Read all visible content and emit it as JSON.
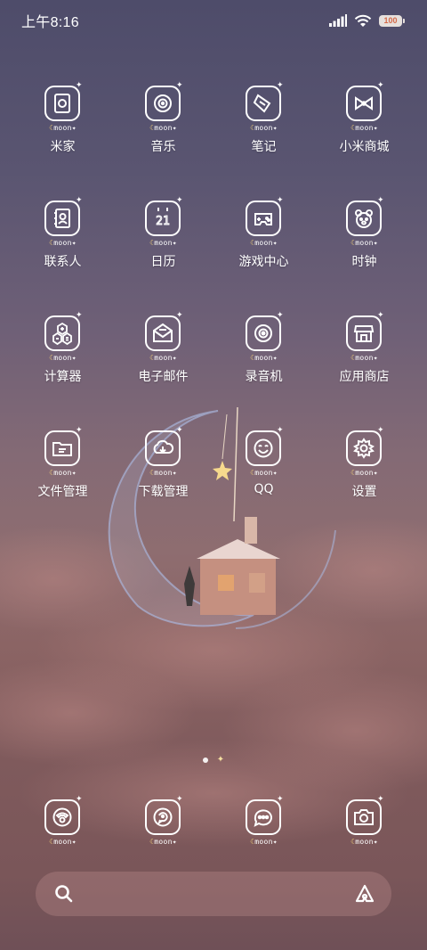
{
  "status_bar": {
    "time": "上午8:16",
    "battery": "100",
    "icons": [
      "signal-icon",
      "wifi-icon",
      "battery-icon"
    ]
  },
  "apps": [
    {
      "label": "米家",
      "icon": "mijia-icon"
    },
    {
      "label": "音乐",
      "icon": "music-icon"
    },
    {
      "label": "笔记",
      "icon": "notes-icon"
    },
    {
      "label": "小米商城",
      "icon": "shop-icon"
    },
    {
      "label": "联系人",
      "icon": "contacts-icon"
    },
    {
      "label": "日历",
      "icon": "calendar-icon"
    },
    {
      "label": "游戏中心",
      "icon": "game-icon"
    },
    {
      "label": "时钟",
      "icon": "clock-icon"
    },
    {
      "label": "计算器",
      "icon": "calculator-icon"
    },
    {
      "label": "电子邮件",
      "icon": "email-icon"
    },
    {
      "label": "录音机",
      "icon": "recorder-icon"
    },
    {
      "label": "应用商店",
      "icon": "app-store-icon"
    },
    {
      "label": "文件管理",
      "icon": "files-icon"
    },
    {
      "label": "下载管理",
      "icon": "download-icon"
    },
    {
      "label": "QQ",
      "icon": "qq-icon"
    },
    {
      "label": "设置",
      "icon": "settings-icon"
    }
  ],
  "icon_tag": "moon",
  "calendar_day": "21",
  "dock": [
    {
      "icon": "phone-icon"
    },
    {
      "icon": "messages-icon"
    },
    {
      "icon": "chat-icon"
    },
    {
      "icon": "camera-icon"
    }
  ],
  "page_indicator": {
    "pages": 2,
    "current": 0
  },
  "search_bar": {
    "left_icon": "search-icon",
    "right_icon": "assistant-icon"
  },
  "colors": {
    "accent_moon": "#f4d37a",
    "battery_text": "#d46a4a"
  }
}
